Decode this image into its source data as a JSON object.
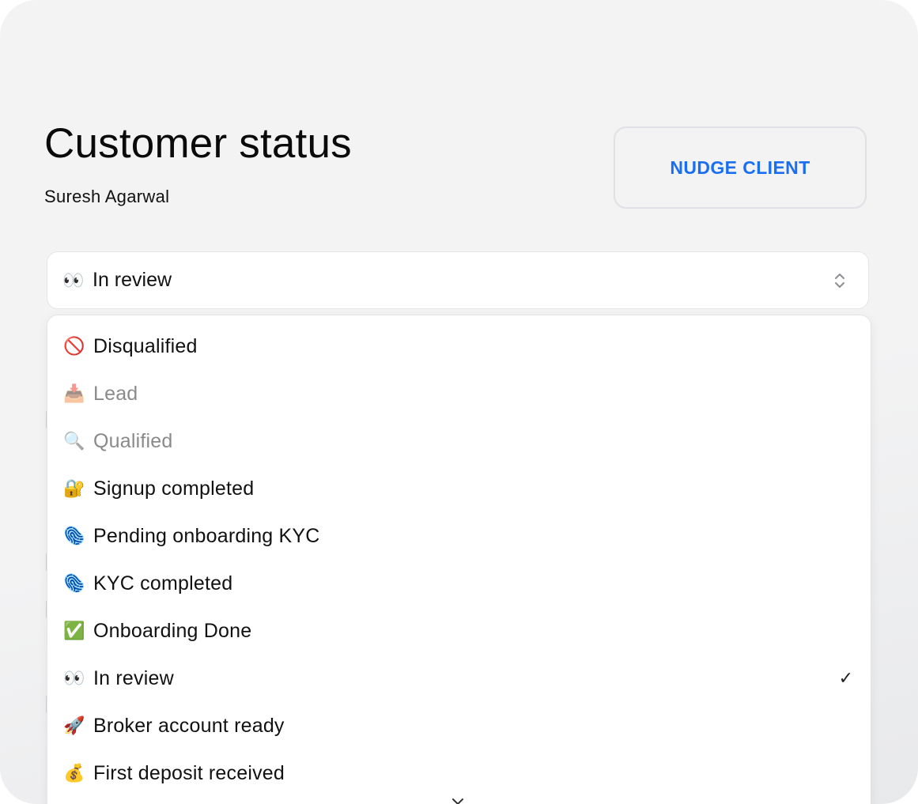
{
  "header": {
    "title": "Customer status",
    "customer_name": "Suresh Agarwal",
    "nudge_label": "NUDGE CLIENT"
  },
  "status_select": {
    "selected_icon": "👀",
    "selected_label": "In review",
    "icon_name": "chevron-up-down-icon"
  },
  "status_options": [
    {
      "icon": "🚫",
      "label": "Disqualified",
      "enabled": true
    },
    {
      "icon": "📥",
      "label": "Lead",
      "enabled": false
    },
    {
      "icon": "🔍",
      "label": "Qualified",
      "enabled": false
    },
    {
      "icon": "🔐",
      "label": "Signup completed",
      "enabled": true
    },
    {
      "icon": "🫆",
      "label": "Pending onboarding KYC",
      "enabled": true
    },
    {
      "icon": "🫆",
      "label": "KYC completed",
      "enabled": true
    },
    {
      "icon": "✅",
      "label": "Onboarding Done",
      "enabled": true
    },
    {
      "icon": "👀",
      "label": "In review",
      "enabled": true,
      "selected": true,
      "check": "✓"
    },
    {
      "icon": "🚀",
      "label": "Broker account ready",
      "enabled": true
    },
    {
      "icon": "💰",
      "label": "First deposit received",
      "enabled": true
    }
  ],
  "colors": {
    "accent": "#1a6ff0",
    "background": "#f3f3f4",
    "disabled_text": "#8a8a8c"
  }
}
